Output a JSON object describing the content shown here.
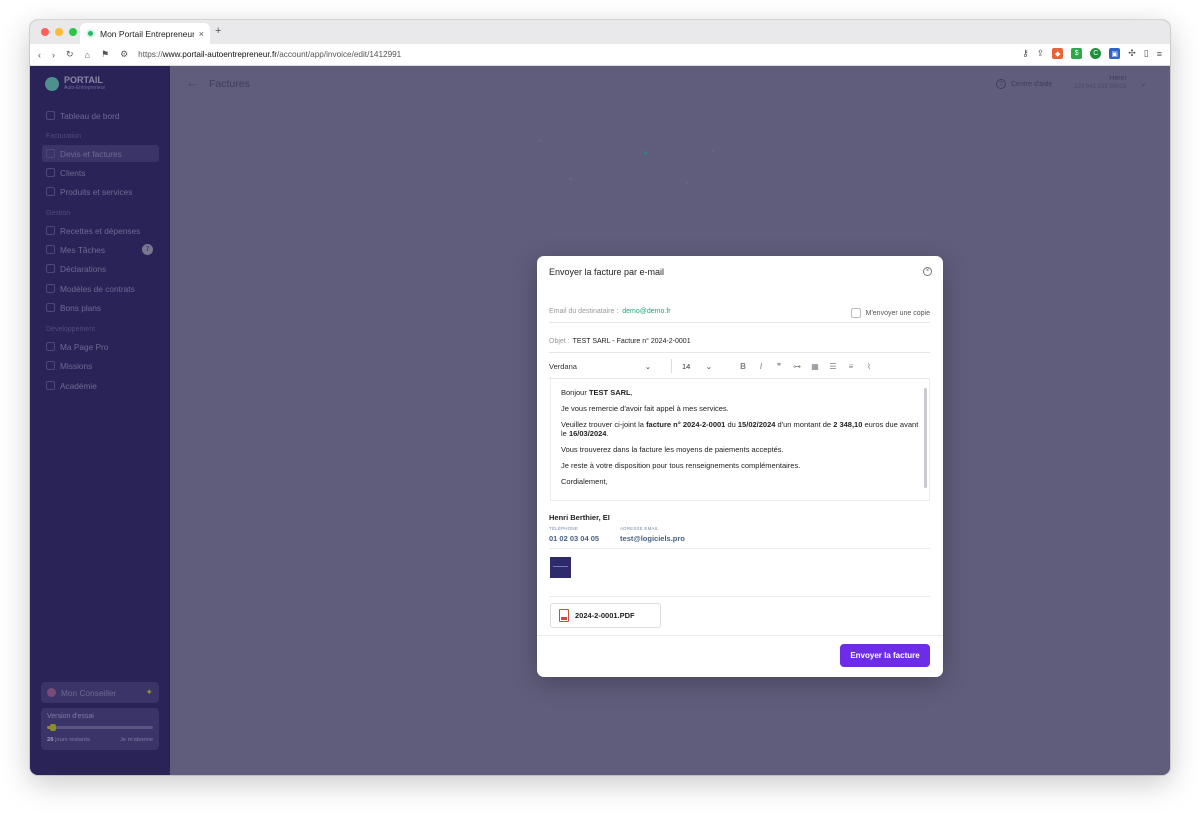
{
  "browser": {
    "tab_title": "Mon Portail Entrepreneur",
    "tab_close": "×",
    "new_tab": "+",
    "url_prefix": "https://",
    "url_host": "www.portail-autoentrepreneur.fr",
    "url_path": "/account/app/invoice/edit/1412991",
    "lights": [
      "#ff5f57",
      "#febc2e",
      "#28c840"
    ]
  },
  "sidebar": {
    "logo_title": "PORTAIL",
    "logo_sub": "Auto-Entrepreneur",
    "dashboard": "Tableau de bord",
    "section_billing": "Facturation",
    "quotes_invoices": "Devis et factures",
    "clients": "Clients",
    "products": "Produits et services",
    "section_management": "Gestion",
    "income_expenses": "Recettes et dépenses",
    "tasks": "Mes Tâches",
    "tasks_badge": "7",
    "declarations": "Déclarations",
    "contract_models": "Modèles de contrats",
    "deals": "Bons plans",
    "section_dev": "Développement",
    "my_page": "Ma Page Pro",
    "missions": "Missions",
    "academy": "Académie",
    "advisor": "Mon Conseiller",
    "trial_label": "Version d'essai",
    "trial_days_num": "28",
    "trial_days_text": "jours restants",
    "trial_subscribe": "Je m'abonne",
    "trial_progress": 0.05
  },
  "header": {
    "back": "←",
    "title": "Factures",
    "help": "Centre d'aide",
    "user_name": "Henri",
    "user_sub": "123 641 239 00019"
  },
  "modal": {
    "title": "Envoyer la facture par e-mail",
    "to_label": "Email du destinataire :",
    "to_value": "demo@demo.fr",
    "copy_label": "M'envoyer une copie",
    "subject_label": "Objet :",
    "subject_value": "TEST SARL - Facture n° 2024-2-0001",
    "font": "Verdana",
    "font_size": "14",
    "body": {
      "greeting": "Bonjour",
      "client": "TEST SARL",
      "thanks": "Je vous remercie d'avoir fait appel à mes services.",
      "p1_a": "Veuillez trouver ci-joint la",
      "p1_invoice": "facture n° 2024-2-0001",
      "p1_b": "du",
      "p1_date": "15/02/2024",
      "p1_c": "d'un montant de",
      "p1_amount": "2 348,10",
      "p1_d": "euros due avant le",
      "p1_due": "16/03/2024",
      "payments": "Vous trouverez dans la facture les moyens de paiements acceptés.",
      "available": "Je reste à votre disposition pour tous renseignements complémentaires.",
      "closing": "Cordialement,"
    },
    "signature": {
      "name": "Henri Berthier, EI",
      "phone_label": "TÉLÉPHONE",
      "phone": "01 02 03 04 05",
      "email_label": "ADRESSE EMAIL",
      "email": "test@logiciels.pro"
    },
    "attachment": "2024-2-0001.PDF",
    "send": "Envoyer la facture",
    "accent": "#6c2ce8"
  }
}
